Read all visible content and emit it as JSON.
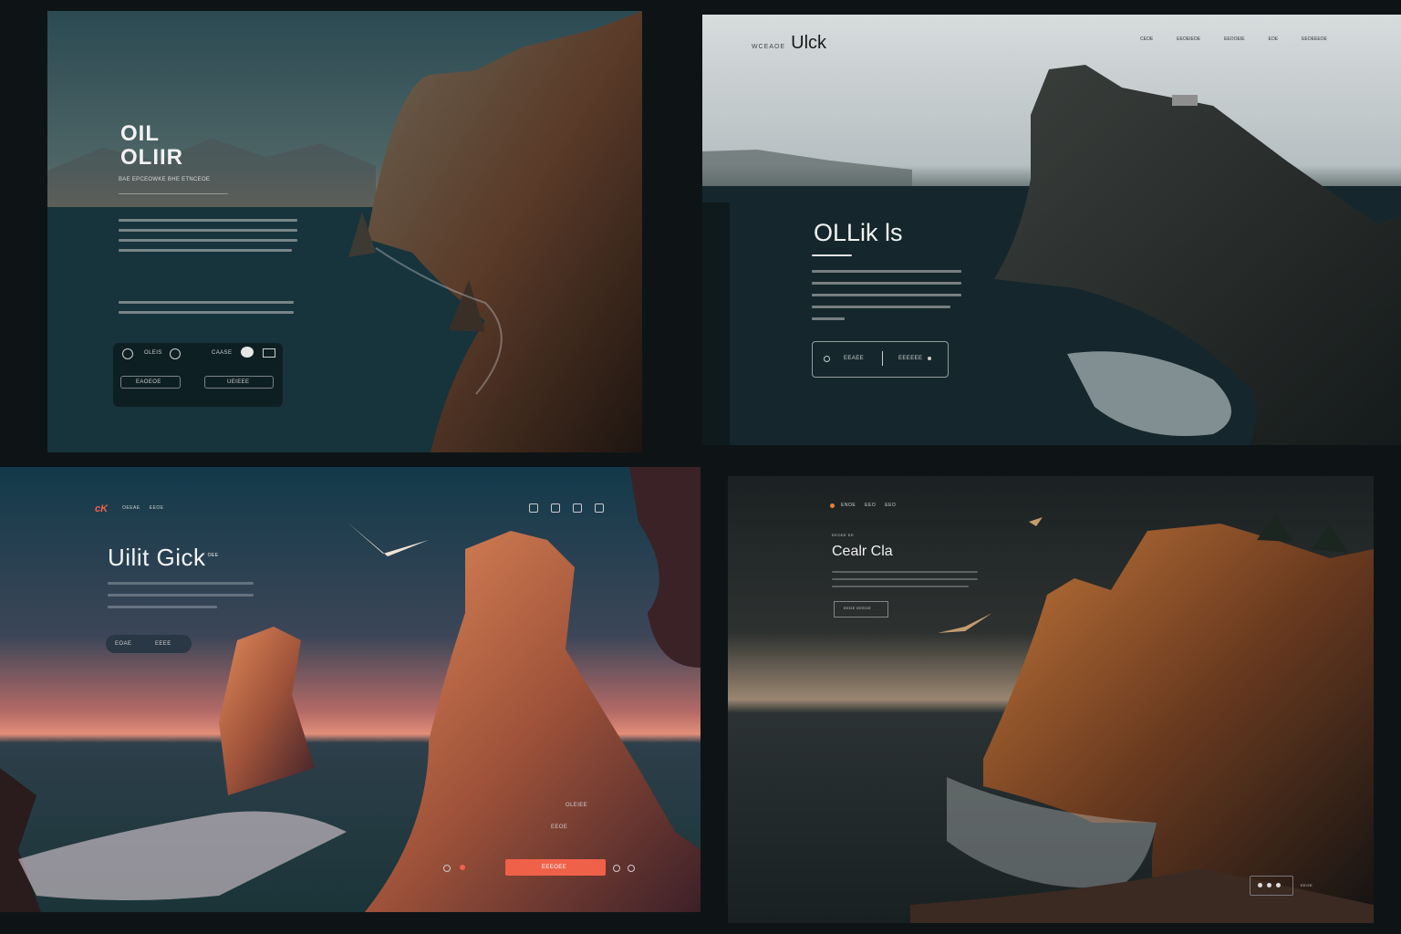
{
  "panel1": {
    "title_line1": "OIL",
    "title_line2": "OLIIR",
    "subtitle": "BAE EPCEOWKE BHE ETNCEOE",
    "card": {
      "row1_label": "OLEIS",
      "row1_label2": "CAASE",
      "button1": "EAOEOE",
      "button2": "UEIEEE"
    }
  },
  "panel2": {
    "brand_small": "WCEAOE",
    "brand_big": "Ulck",
    "nav": [
      "CEOE",
      "EEOEIEOE",
      "EEOOEIE",
      "EOE",
      "EEOEEEOE"
    ],
    "title": "OLLik ls",
    "cta": {
      "label1": "EEAEE",
      "label2": "EEEEEE"
    }
  },
  "panel3": {
    "logo": "cK",
    "nav": [
      "OEEAE",
      "EEOE"
    ],
    "title": "Uilit Gick",
    "title_sup": "OEE",
    "cta": {
      "label1": "EOAE",
      "label2": "EEEE"
    },
    "orange_label": "EEEOEE",
    "side_labels": [
      "OLEIEE",
      "EEOE"
    ]
  },
  "panel4": {
    "nav": [
      "ENOE",
      "EEO",
      "EEO"
    ],
    "kicker": "EEOEE EE",
    "title": "Cealr Cla",
    "cta": "EEOE EEEOE",
    "footer_label": "EEOE"
  }
}
